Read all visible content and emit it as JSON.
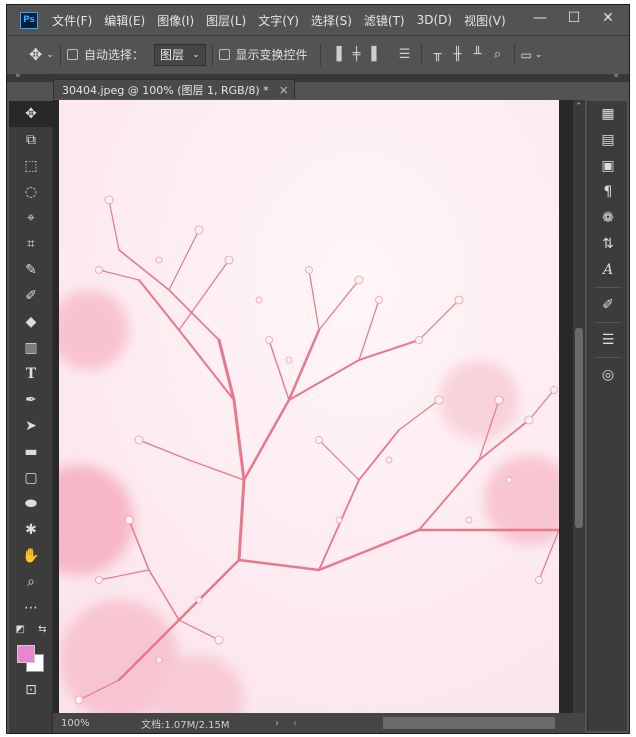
{
  "app": {
    "logo": "Ps"
  },
  "menu": [
    "文件(F)",
    "编辑(E)",
    "图像(I)",
    "图层(L)",
    "文字(Y)",
    "选择(S)",
    "滤镜(T)",
    "3D(D)",
    "视图(V)"
  ],
  "window_controls": {
    "minimize": "—",
    "maximize": "☐",
    "close": "✕"
  },
  "options": {
    "auto_select_label": "自动选择：",
    "layer_select_value": "图层",
    "show_transform_label": "显示变换控件"
  },
  "document": {
    "tab_title": "30404.jpeg @ 100% (图层 1, RGB/8) *",
    "close_label": "×"
  },
  "status": {
    "zoom": "100%",
    "doc_info": "文档:1.07M/2.15M"
  },
  "colors": {
    "foreground": "#ec84d0",
    "background": "#ffffff"
  },
  "tools": [
    "move-icon",
    "artboard-icon",
    "marquee-icon",
    "lasso-icon",
    "quick-select-icon",
    "crop-icon",
    "eyedropper-icon",
    "brush-icon",
    "eraser-icon",
    "gradient-icon",
    "type-icon",
    "pen-icon",
    "path-select-icon",
    "rectangle-icon",
    "rounded-rect-icon",
    "ellipse-icon",
    "custom-shape-icon",
    "hand-icon",
    "zoom-icon",
    "more-icon"
  ],
  "panels": [
    "grid-icon",
    "notes-icon",
    "properties-icon",
    "paragraph-icon",
    "color-palette-icon",
    "adjustments-icon",
    "character-icon",
    "brushes-icon",
    "sliders-icon",
    "channels-icon"
  ]
}
